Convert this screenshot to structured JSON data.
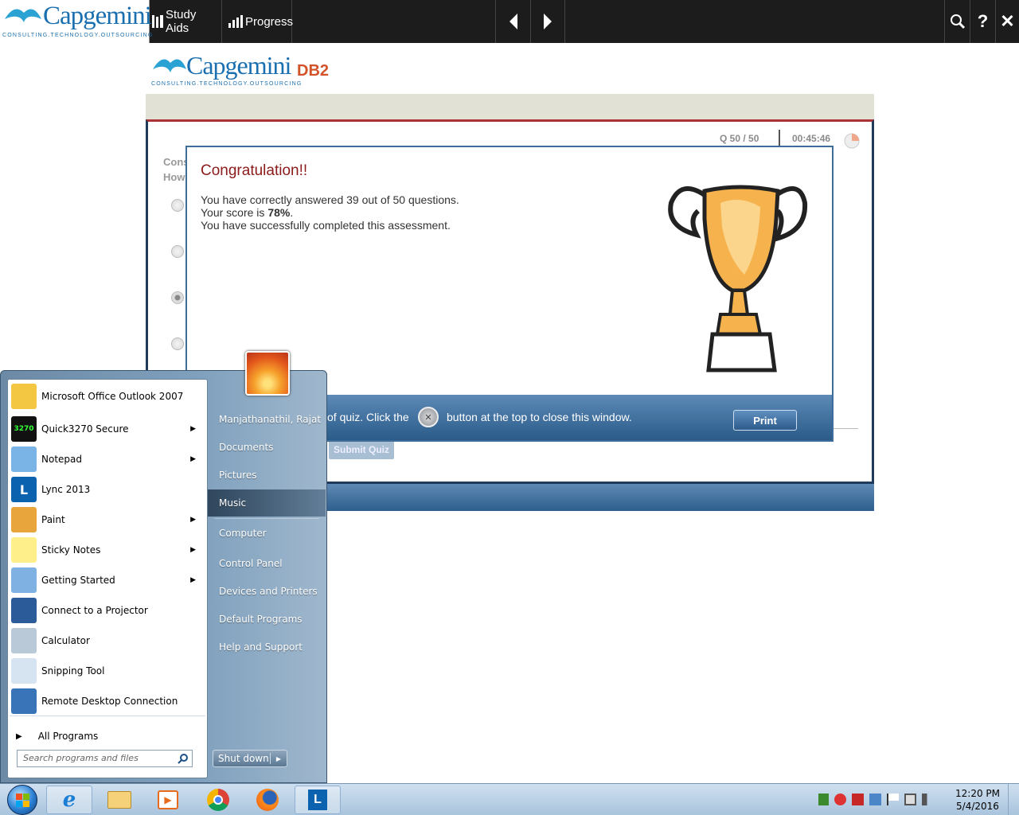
{
  "topbar": {
    "logo_word": "Capgemini",
    "logo_tag": "CONSULTING.TECHNOLOGY.OUTSOURCING",
    "study_aids": "Study Aids",
    "progress": "Progress",
    "icons": [
      "prev-icon",
      "next-icon",
      "search-icon",
      "help-icon",
      "close-icon"
    ]
  },
  "course": {
    "logo_word": "Capgemini",
    "logo_tag": "CONSULTING.TECHNOLOGY.OUTSOURCING",
    "title": "DB2",
    "question_counter": "Q 50 / 50",
    "timer": "00:45:46",
    "question_line1": "Cons",
    "question_line2": "How",
    "submit_label": "Submit Quiz"
  },
  "dialog": {
    "heading": "Congratulation!!",
    "line1": "You have correctly answered 39 out of 50 questions.",
    "line2_prefix": "Your score is ",
    "score": "78%",
    "line2_suffix": ".",
    "line3": "You have successfully completed this assessment.",
    "footer_text_a": "of quiz. Click the",
    "footer_text_b": "button at the top to close this window.",
    "print_label": "Print"
  },
  "startmenu": {
    "programs": [
      {
        "label": "Microsoft Office Outlook 2007",
        "icon": "outlook-icon",
        "submenu": false
      },
      {
        "label": "Quick3270 Secure",
        "icon": "quick3270-icon",
        "submenu": true
      },
      {
        "label": "Notepad",
        "icon": "notepad-icon",
        "submenu": true
      },
      {
        "label": "Lync 2013",
        "icon": "lync-icon",
        "submenu": false
      },
      {
        "label": "Paint",
        "icon": "paint-icon",
        "submenu": true
      },
      {
        "label": "Sticky Notes",
        "icon": "sticky-notes-icon",
        "submenu": true
      },
      {
        "label": "Getting Started",
        "icon": "getting-started-icon",
        "submenu": true
      },
      {
        "label": "Connect to a Projector",
        "icon": "projector-icon",
        "submenu": false
      },
      {
        "label": "Calculator",
        "icon": "calculator-icon",
        "submenu": false
      },
      {
        "label": "Snipping Tool",
        "icon": "snipping-tool-icon",
        "submenu": false
      },
      {
        "label": "Remote Desktop Connection",
        "icon": "remote-desktop-icon",
        "submenu": false
      }
    ],
    "all_programs": "All Programs",
    "search_placeholder": "Search programs and files",
    "user": "Manjathanathil, Rajat",
    "links": [
      "Documents",
      "Pictures",
      "Music",
      "Computer",
      "Control Panel",
      "Devices and Printers",
      "Default Programs",
      "Help and Support"
    ],
    "shutdown": "Shut down",
    "quick3270_badge": "3270"
  },
  "taskbar": {
    "time": "12:20 PM",
    "date": "5/4/2016",
    "buttons": [
      "start-orb",
      "internet-explorer",
      "file-explorer",
      "media-player",
      "chrome",
      "firefox",
      "lync"
    ]
  }
}
